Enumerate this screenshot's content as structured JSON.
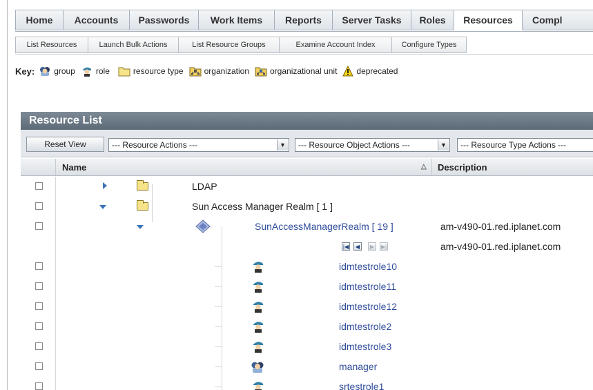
{
  "main_tabs": [
    "Home",
    "Accounts",
    "Passwords",
    "Work Items",
    "Reports",
    "Server Tasks",
    "Roles",
    "Resources",
    "Compl"
  ],
  "active_main_tab": "Resources",
  "sub_tabs": [
    "List Resources",
    "Launch Bulk Actions",
    "List Resource Groups",
    "Examine Account Index",
    "Configure Types"
  ],
  "key": {
    "label": "Key:",
    "items": [
      {
        "icon": "group-icon",
        "label": "group"
      },
      {
        "icon": "role-icon",
        "label": "role"
      },
      {
        "icon": "folder-icon",
        "label": "resource type"
      },
      {
        "icon": "organization-icon",
        "label": "organization"
      },
      {
        "icon": "organizational-unit-icon",
        "label": "organizational unit"
      },
      {
        "icon": "warning-icon",
        "label": "deprecated"
      }
    ]
  },
  "resource_list": {
    "title": "Resource List",
    "reset_button": "Reset View",
    "resource_actions": "--- Resource Actions ---",
    "resource_object_actions": "--- Resource Object Actions ---",
    "resource_type_actions": "--- Resource Type Actions ---",
    "col_name": "Name",
    "col_description": "Description",
    "rows": [
      {
        "name": "LDAP",
        "description": ""
      },
      {
        "name": "Sun Access Manager Realm [ 1 ]",
        "description": ""
      },
      {
        "name": "SunAccessManagerRealm [ 19 ]",
        "description": "am-v490-01.red.iplanet.com"
      },
      {
        "name": "",
        "description": "am-v490-01.red.iplanet.com"
      },
      {
        "name": "idmtestrole10",
        "description": ""
      },
      {
        "name": "idmtestrole11",
        "description": ""
      },
      {
        "name": "idmtestrole12",
        "description": ""
      },
      {
        "name": "idmtestrole2",
        "description": ""
      },
      {
        "name": "idmtestrole3",
        "description": ""
      },
      {
        "name": "manager",
        "description": ""
      },
      {
        "name": "srtestrole1",
        "description": ""
      }
    ]
  },
  "colors": {
    "accent": "#2e4c9b",
    "header": "#6b7884"
  }
}
